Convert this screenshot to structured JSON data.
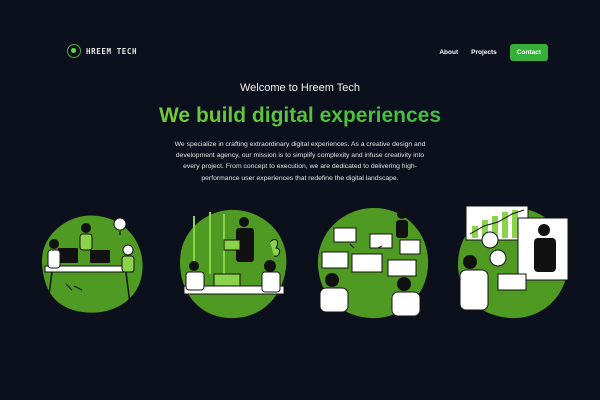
{
  "brand": {
    "name": "HREEM TECH"
  },
  "nav": {
    "links": [
      "About",
      "Projects"
    ],
    "contact_label": "Contact"
  },
  "hero": {
    "welcome": "Welcome to Hreem Tech",
    "headline": "We build digital experiences",
    "description": "We specialize in crafting extraordinary digital experiences. As a creative design and development agency, our mission is to simplify complexity and infuse creativity into every project. From concept to execution, we are dedicated to delivering high-performance user experiences that redefine the digital landscape."
  },
  "illustrations": [
    "team-brainstorm",
    "office-collaboration",
    "workspace-monitors",
    "finance-growth"
  ],
  "colors": {
    "background": "#0c0f1c",
    "accent": "#36b03b",
    "illustration_green": "#4f9a22"
  }
}
